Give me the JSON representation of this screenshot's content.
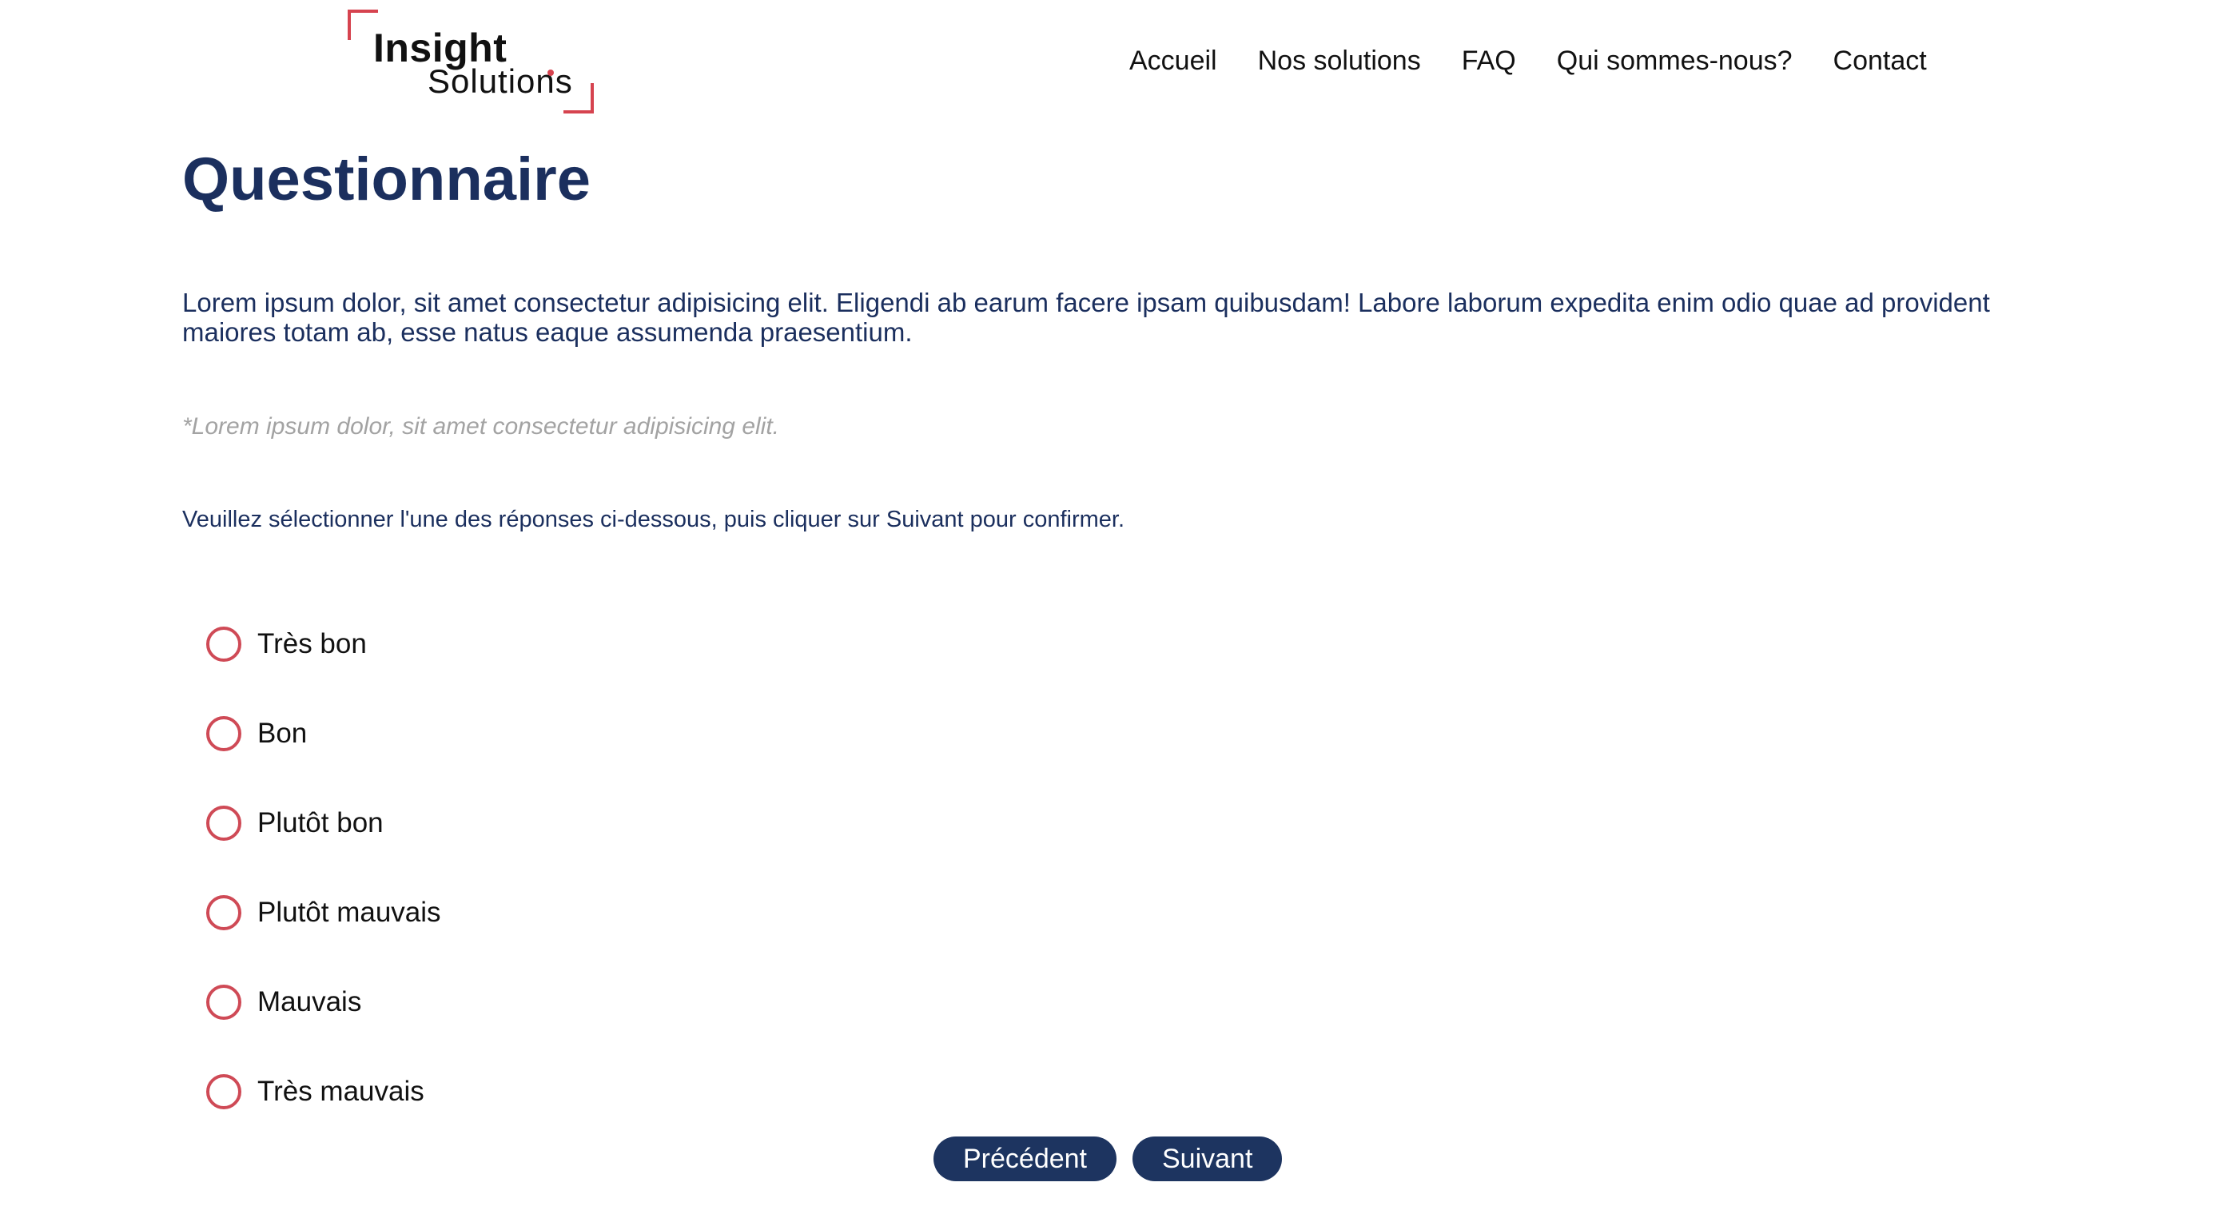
{
  "brand": {
    "name_line1": "Insight",
    "name_line2": "Solutions",
    "accent_color": "#d6434f"
  },
  "nav": {
    "items": [
      {
        "label": "Accueil"
      },
      {
        "label": "Nos solutions"
      },
      {
        "label": "FAQ"
      },
      {
        "label": "Qui sommes-nous?"
      },
      {
        "label": "Contact"
      }
    ]
  },
  "main": {
    "title": "Questionnaire",
    "intro": "Lorem ipsum dolor, sit amet consectetur adipisicing elit. Eligendi ab earum facere ipsam quibusdam! Labore laborum expedita enim odio quae ad provident maiores totam ab, esse natus eaque assumenda praesentium.",
    "note": "*Lorem ipsum dolor, sit amet consectetur adipisicing elit.",
    "instruction": "Veuillez sélectionner l'une des réponses ci-dessous, puis cliquer sur Suivant pour confirmer.",
    "options": [
      {
        "label": "Très bon",
        "selected": false
      },
      {
        "label": "Bon",
        "selected": false
      },
      {
        "label": "Plutôt bon",
        "selected": false
      },
      {
        "label": "Plutôt mauvais",
        "selected": false
      },
      {
        "label": "Mauvais",
        "selected": false
      },
      {
        "label": "Très mauvais",
        "selected": false
      }
    ],
    "buttons": {
      "previous": "Précédent",
      "next": "Suivant"
    }
  },
  "colors": {
    "title": "#1b2f5e",
    "radio_border": "#cf4a56",
    "button_bg": "#1d3460",
    "note_text": "#a3a3a3"
  }
}
